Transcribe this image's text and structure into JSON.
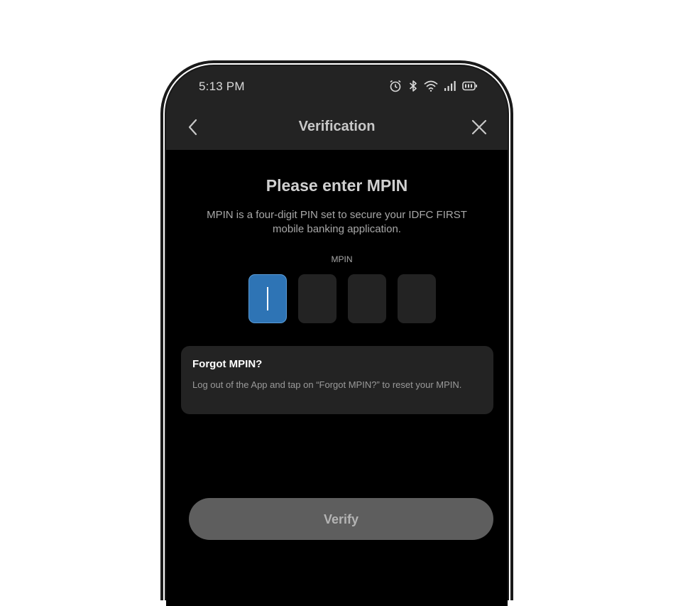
{
  "status_bar": {
    "time": "5:13 PM",
    "icons": [
      "alarm-icon",
      "bluetooth-icon",
      "wifi-icon",
      "signal-icon",
      "battery-icon"
    ]
  },
  "header": {
    "title": "Verification",
    "back_icon": "chevron-left-icon",
    "close_icon": "close-icon"
  },
  "main": {
    "heading": "Please enter MPIN",
    "description": "MPIN is a four-digit PIN set to secure your IDFC FIRST mobile banking application.",
    "mpin_label": "MPIN",
    "pin_digits": [
      "",
      "",
      "",
      ""
    ],
    "active_digit_index": 0
  },
  "forgot_card": {
    "title": "Forgot MPIN?",
    "text": "Log out of the App and tap on “Forgot MPIN?” to reset your MPIN."
  },
  "footer": {
    "verify_label": "Verify"
  },
  "colors": {
    "active_pin": "#2e74b5",
    "background": "#000000",
    "panel": "#232323",
    "button_disabled": "#5e5e5e"
  }
}
